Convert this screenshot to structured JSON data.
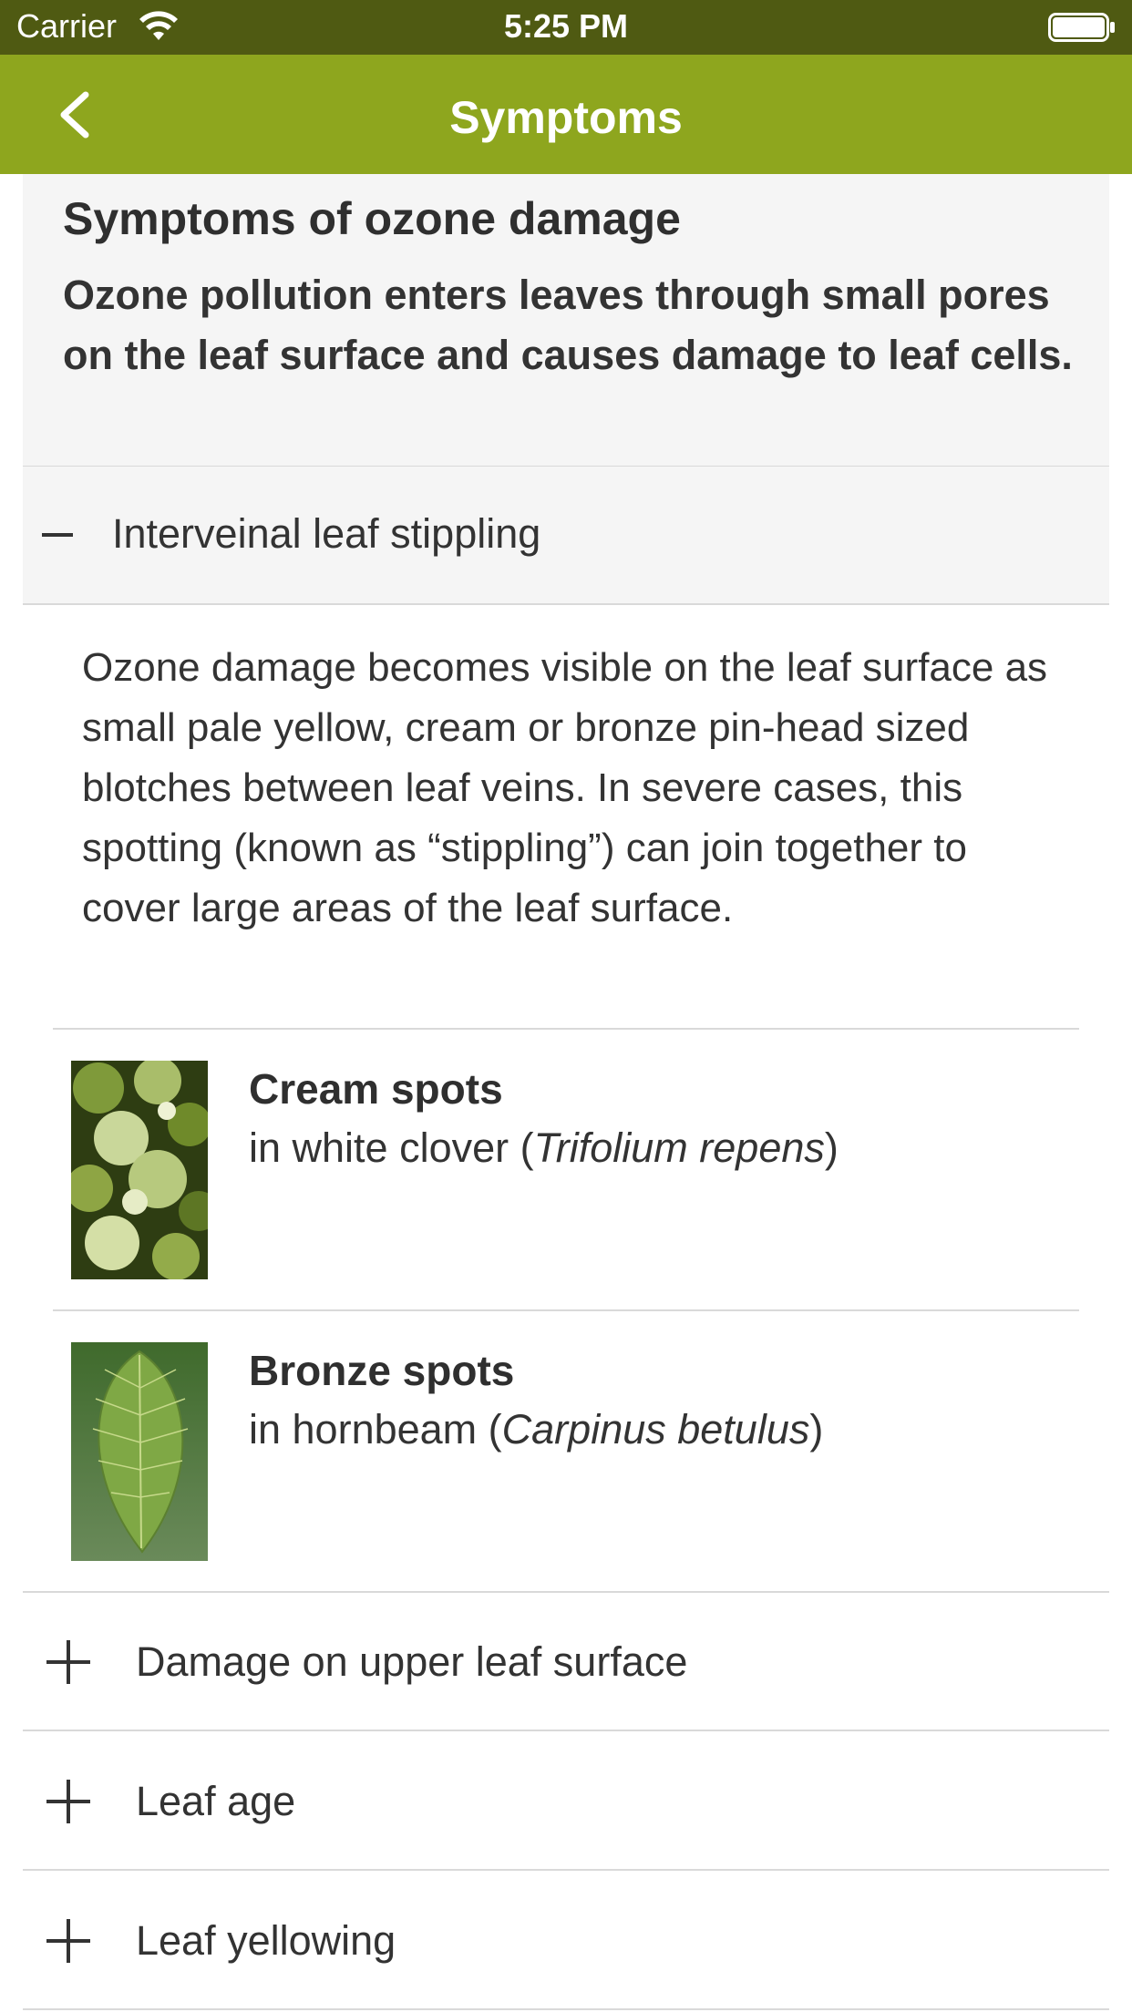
{
  "status_bar": {
    "carrier": "Carrier",
    "time": "5:25 PM",
    "icons": [
      "wifi-icon",
      "battery-icon"
    ]
  },
  "nav": {
    "title": "Symptoms",
    "back_icon": "chevron-left-icon"
  },
  "intro": {
    "heading": "Symptoms of ozone damage",
    "text": "Ozone pollution enters leaves through small pores on the leaf surface and causes damage to leaf cells."
  },
  "sections": [
    {
      "label": "Interveinal leaf stippling",
      "expanded": true,
      "icon": "minus-icon",
      "body": "Ozone damage becomes visible on the leaf surface as small pale yellow, cream or bronze pin-head sized blotches between leaf veins. In severe cases, this spotting (known as “stippling”) can join together to cover large areas of the leaf surface.",
      "examples": [
        {
          "title": "Cream spots",
          "sub_prefix": "in white clover (",
          "sub_latin": "Trifolium repens",
          "sub_suffix": ")",
          "image": "clover-leaf-image"
        },
        {
          "title": "Bronze spots",
          "sub_prefix": "in hornbeam (",
          "sub_latin": "Carpinus betulus",
          "sub_suffix": ")",
          "image": "hornbeam-leaf-image"
        }
      ]
    },
    {
      "label": "Damage on upper leaf surface",
      "expanded": false,
      "icon": "plus-icon"
    },
    {
      "label": "Leaf age",
      "expanded": false,
      "icon": "plus-icon"
    },
    {
      "label": "Leaf yellowing",
      "expanded": false,
      "icon": "plus-icon"
    }
  ],
  "colors": {
    "status_bar": "#4f5a12",
    "nav_bar": "#8ea61e",
    "section_bg": "#f5f5f5",
    "divider": "#d9d9d9",
    "text": "#333333"
  }
}
